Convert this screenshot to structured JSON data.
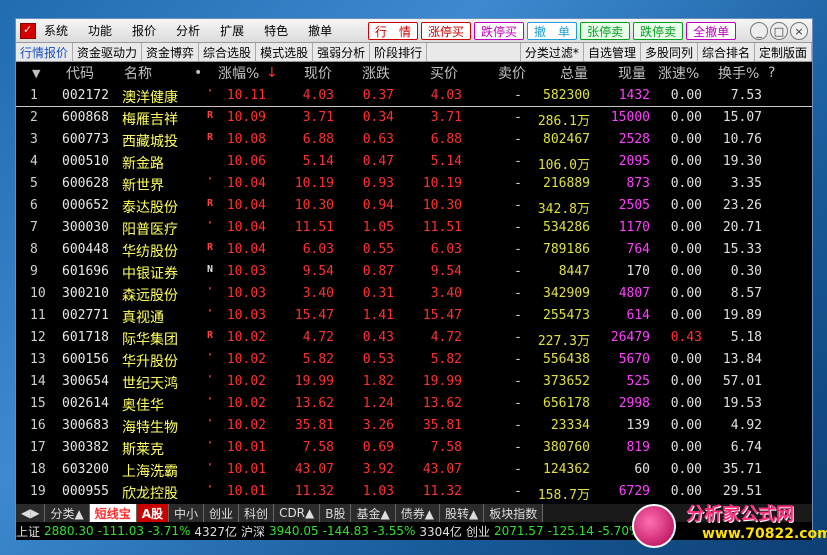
{
  "menubar": {
    "items": [
      "系统",
      "功能",
      "报价",
      "分析",
      "扩展",
      "特色",
      "撤单"
    ],
    "trade_buttons": [
      {
        "label": "行　情",
        "style": "red"
      },
      {
        "label": "涨停买",
        "style": "red"
      },
      {
        "label": "跌停买",
        "style": "purple"
      },
      {
        "label": "撤　单",
        "style": "blue"
      },
      {
        "label": "张停卖",
        "style": "green"
      },
      {
        "label": "跌停卖",
        "style": "green"
      },
      {
        "label": "全撤单",
        "style": "purple"
      }
    ],
    "window_controls": [
      "_",
      "□",
      "×"
    ]
  },
  "tabs": {
    "left": [
      "行情报价",
      "资金驱动力",
      "资金博弈",
      "综合选股",
      "模式选股",
      "强弱分析",
      "阶段排行"
    ],
    "right": [
      "分类过滤*",
      "自选管理",
      "多股同列",
      "综合排名",
      "定制版面"
    ],
    "active": "行情报价"
  },
  "header": {
    "sort_arrow": "▼",
    "code": "代码",
    "name": "名称",
    "dot": "•",
    "pct": "涨幅%",
    "sort_mark": "↓",
    "price": "现价",
    "change": "涨跌",
    "bid": "买价",
    "ask": "卖价",
    "volume": "总量",
    "cur_volume": "现量",
    "speed": "涨速%",
    "turnover": "换手%",
    "help": "?"
  },
  "rows": [
    {
      "idx": "1",
      "code": "002172",
      "name": "澳洋健康",
      "flag": "'",
      "pct": "10.11",
      "price": "4.03",
      "chg": "0.37",
      "bid": "4.03",
      "ask": "-",
      "vol": "582300",
      "cur": "1432",
      "spd": "0.00",
      "turn": "7.53"
    },
    {
      "idx": "2",
      "code": "600868",
      "name": "梅雁吉祥",
      "flag": "R",
      "pct": "10.09",
      "price": "3.71",
      "chg": "0.34",
      "bid": "3.71",
      "ask": "-",
      "vol": "286.1万",
      "cur": "15000",
      "spd": "0.00",
      "turn": "15.07"
    },
    {
      "idx": "3",
      "code": "600773",
      "name": "西藏城投",
      "flag": "R",
      "pct": "10.08",
      "price": "6.88",
      "chg": "0.63",
      "bid": "6.88",
      "ask": "-",
      "vol": "802467",
      "cur": "2528",
      "spd": "0.00",
      "turn": "10.76"
    },
    {
      "idx": "4",
      "code": "000510",
      "name": "新金路",
      "flag": "",
      "pct": "10.06",
      "price": "5.14",
      "chg": "0.47",
      "bid": "5.14",
      "ask": "-",
      "vol": "106.0万",
      "cur": "2095",
      "spd": "0.00",
      "turn": "19.30"
    },
    {
      "idx": "5",
      "code": "600628",
      "name": "新世界",
      "flag": "'",
      "pct": "10.04",
      "price": "10.19",
      "chg": "0.93",
      "bid": "10.19",
      "ask": "-",
      "vol": "216889",
      "cur": "873",
      "spd": "0.00",
      "turn": "3.35"
    },
    {
      "idx": "6",
      "code": "000652",
      "name": "泰达股份",
      "flag": "R",
      "pct": "10.04",
      "price": "10.30",
      "chg": "0.94",
      "bid": "10.30",
      "ask": "-",
      "vol": "342.8万",
      "cur": "2505",
      "spd": "0.00",
      "turn": "23.26"
    },
    {
      "idx": "7",
      "code": "300030",
      "name": "阳普医疗",
      "flag": "'",
      "pct": "10.04",
      "price": "11.51",
      "chg": "1.05",
      "bid": "11.51",
      "ask": "-",
      "vol": "534286",
      "cur": "1170",
      "spd": "0.00",
      "turn": "20.71"
    },
    {
      "idx": "8",
      "code": "600448",
      "name": "华纺股份",
      "flag": "R",
      "pct": "10.04",
      "price": "6.03",
      "chg": "0.55",
      "bid": "6.03",
      "ask": "-",
      "vol": "789186",
      "cur": "764",
      "spd": "0.00",
      "turn": "15.33"
    },
    {
      "idx": "9",
      "code": "601696",
      "name": "中银证券",
      "flag": "N",
      "pct": "10.03",
      "price": "9.54",
      "chg": "0.87",
      "bid": "9.54",
      "ask": "-",
      "vol": "8447",
      "cur": "170",
      "spd": "0.00",
      "turn": "0.30"
    },
    {
      "idx": "10",
      "code": "300210",
      "name": "森远股份",
      "flag": "'",
      "pct": "10.03",
      "price": "3.40",
      "chg": "0.31",
      "bid": "3.40",
      "ask": "-",
      "vol": "342909",
      "cur": "4807",
      "spd": "0.00",
      "turn": "8.57"
    },
    {
      "idx": "11",
      "code": "002771",
      "name": "真视通",
      "flag": "'",
      "pct": "10.03",
      "price": "15.47",
      "chg": "1.41",
      "bid": "15.47",
      "ask": "-",
      "vol": "255473",
      "cur": "614",
      "spd": "0.00",
      "turn": "19.89"
    },
    {
      "idx": "12",
      "code": "601718",
      "name": "际华集团",
      "flag": "R",
      "pct": "10.02",
      "price": "4.72",
      "chg": "0.43",
      "bid": "4.72",
      "ask": "-",
      "vol": "227.3万",
      "cur": "26479",
      "spd": "0.43",
      "turn": "5.18"
    },
    {
      "idx": "13",
      "code": "600156",
      "name": "华升股份",
      "flag": "'",
      "pct": "10.02",
      "price": "5.82",
      "chg": "0.53",
      "bid": "5.82",
      "ask": "-",
      "vol": "556438",
      "cur": "5670",
      "spd": "0.00",
      "turn": "13.84"
    },
    {
      "idx": "14",
      "code": "300654",
      "name": "世纪天鸿",
      "flag": "'",
      "pct": "10.02",
      "price": "19.99",
      "chg": "1.82",
      "bid": "19.99",
      "ask": "-",
      "vol": "373652",
      "cur": "525",
      "spd": "0.00",
      "turn": "57.01"
    },
    {
      "idx": "15",
      "code": "002614",
      "name": "奥佳华",
      "flag": "'",
      "pct": "10.02",
      "price": "13.62",
      "chg": "1.24",
      "bid": "13.62",
      "ask": "-",
      "vol": "656178",
      "cur": "2998",
      "spd": "0.00",
      "turn": "19.53"
    },
    {
      "idx": "16",
      "code": "300683",
      "name": "海特生物",
      "flag": "'",
      "pct": "10.02",
      "price": "35.81",
      "chg": "3.26",
      "bid": "35.81",
      "ask": "-",
      "vol": "23334",
      "cur": "139",
      "spd": "0.00",
      "turn": "4.92"
    },
    {
      "idx": "17",
      "code": "300382",
      "name": "斯莱克",
      "flag": "'",
      "pct": "10.01",
      "price": "7.58",
      "chg": "0.69",
      "bid": "7.58",
      "ask": "-",
      "vol": "380760",
      "cur": "819",
      "spd": "0.00",
      "turn": "6.74"
    },
    {
      "idx": "18",
      "code": "603200",
      "name": "上海洗霸",
      "flag": "'",
      "pct": "10.01",
      "price": "43.07",
      "chg": "3.92",
      "bid": "43.07",
      "ask": "-",
      "vol": "124362",
      "cur": "60",
      "spd": "0.00",
      "turn": "35.71"
    },
    {
      "idx": "19",
      "code": "000955",
      "name": "欣龙控股",
      "flag": "'",
      "pct": "10.01",
      "price": "11.32",
      "chg": "1.03",
      "bid": "11.32",
      "ask": "-",
      "vol": "158.7万",
      "cur": "6729",
      "spd": "0.00",
      "turn": "29.51"
    }
  ],
  "category_tabs": [
    {
      "label": "◀▶",
      "style": ""
    },
    {
      "label": "分类▲",
      "style": ""
    },
    {
      "label": "短线宝",
      "style": "hot"
    },
    {
      "label": "A股",
      "style": "act"
    },
    {
      "label": "中小",
      "style": ""
    },
    {
      "label": "创业",
      "style": ""
    },
    {
      "label": "科创",
      "style": ""
    },
    {
      "label": "CDR▲",
      "style": ""
    },
    {
      "label": "B股",
      "style": ""
    },
    {
      "label": "基金▲",
      "style": ""
    },
    {
      "label": "债券▲",
      "style": ""
    },
    {
      "label": "股转▲",
      "style": ""
    },
    {
      "label": "板块指数",
      "style": ""
    }
  ],
  "statusbar": {
    "sh_label": "上证",
    "sh_value": "2880.30",
    "sh_chg": "-111.03",
    "sh_pct": "-3.71%",
    "sh_amt": "4327亿",
    "sz_label": "沪深",
    "sz_value": "3940.05",
    "sz_chg": "-144.83",
    "sz_pct": "-3.55%",
    "sz_amt": "3304亿",
    "cy_label": "创业",
    "cy_value": "2071.57",
    "cy_chg": "-125.14",
    "cy_pct": "-5.70%"
  },
  "logo": {
    "title": "分析家公式网",
    "url": "www.70822.com"
  }
}
